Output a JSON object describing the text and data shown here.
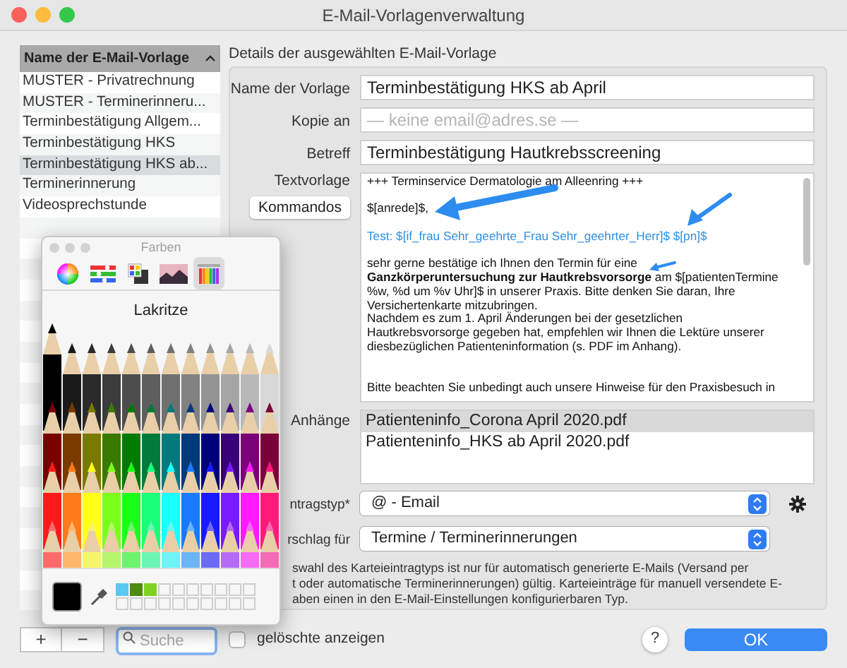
{
  "window": {
    "title": "E-Mail-Vorlagenverwaltung"
  },
  "template_list": {
    "header": "Name der E-Mail-Vorlage",
    "items": [
      {
        "name": "MUSTER - Privatrechnung",
        "selected": false
      },
      {
        "name": "MUSTER - Terminerinneru...",
        "selected": false
      },
      {
        "name": "Terminbestätigung Allgem...",
        "selected": false
      },
      {
        "name": "Terminbestätigung HKS",
        "selected": false
      },
      {
        "name": "Terminbestätigung HKS ab...",
        "selected": true
      },
      {
        "name": "Terminerinnerung",
        "selected": false
      },
      {
        "name": "Videosprechstunde",
        "selected": false
      }
    ]
  },
  "details": {
    "title": "Details der ausgewählten E-Mail-Vorlage",
    "name_label": "Name der Vorlage",
    "name_value": "Terminbestätigung HKS ab April",
    "copy_label": "Kopie an",
    "copy_placeholder": "— keine email@adres.se —",
    "subject_label": "Betreff",
    "subject_value": "Terminbestätigung Hautkrebsscreening",
    "template_label": "Textvorlage",
    "commands_button": "Kommandos",
    "template_lines": [
      {
        "kind": "text",
        "text": "+++ Terminservice Dermatologie am Alleenring +++"
      },
      {
        "kind": "blank"
      },
      {
        "kind": "text",
        "text": "$[anrede]$,"
      },
      {
        "kind": "blank"
      },
      {
        "kind": "link",
        "text": "Test: $[if_frau Sehr_geehrte_Frau Sehr_geehrter_Herr]$ $[pn]$"
      },
      {
        "kind": "blank"
      },
      {
        "kind": "text",
        "text": "sehr gerne bestätige ich Ihnen den Termin für eine"
      },
      {
        "kind": "text",
        "text": "**Ganzkörperuntersuchung zur Hautkrebsvorsorge** am $[patientenTermine"
      },
      {
        "kind": "text",
        "text": "%w, %d um %v Uhr]$ in unserer Praxis. Bitte denken Sie daran, Ihre"
      },
      {
        "kind": "text",
        "text": "Versichertenkarte mitzubringen."
      },
      {
        "kind": "text",
        "text": "Nachdem es zum 1. April Änderungen bei der gesetzlichen"
      },
      {
        "kind": "text",
        "text": "Hautkrebsvorsorge gegeben hat, empfehlen wir Ihnen die Lektüre unserer"
      },
      {
        "kind": "text",
        "text": "diesbezüglichen Patienteninformation (s. PDF im Anhang)."
      },
      {
        "kind": "blank"
      },
      {
        "kind": "blank"
      },
      {
        "kind": "text",
        "text": "Bitte beachten Sie unbedingt auch unsere Hinweise für den Praxisbesuch in"
      }
    ],
    "attachments_label": "Anhänge",
    "attachments": [
      {
        "name": "Patienteninfo_Corona April 2020.pdf",
        "selected": true
      },
      {
        "name": "Patienteninfo_HKS ab April 2020.pdf",
        "selected": false
      }
    ],
    "entry_type_label": "ntragstyp*",
    "entry_type_value": "@ - Email",
    "suggestion_label": "rschlag für",
    "suggestion_value": "Termine / Terminerinnerungen",
    "info_lines": [
      "swahl des Karteieintragtyps ist nur für automatisch generierte E-Mails (Versand per",
      "t oder automatische Terminerinnerungen) gültig. Karteieinträge für manuell versendete E-",
      "aben einen in den E-Mail-Einstellungen konfigurierbaren Typ."
    ]
  },
  "bottom_bar": {
    "add": "+",
    "remove": "−",
    "search_placeholder": "Suche",
    "show_deleted_label": "gelöschte anzeigen",
    "show_deleted_checked": false,
    "help": "?",
    "ok": "OK"
  },
  "colors_panel": {
    "title": "Farben",
    "tabs": [
      {
        "kind": "wheel",
        "selected": false
      },
      {
        "kind": "sliders",
        "selected": false
      },
      {
        "kind": "palettes",
        "selected": false
      },
      {
        "kind": "image",
        "selected": false
      },
      {
        "kind": "pencils",
        "selected": true
      }
    ],
    "pencil_name": "Lakritze",
    "swatches": [
      {
        "color": "#5ac8f0"
      },
      {
        "color": "#4f8a10"
      },
      {
        "color": "#7ed321"
      }
    ]
  }
}
